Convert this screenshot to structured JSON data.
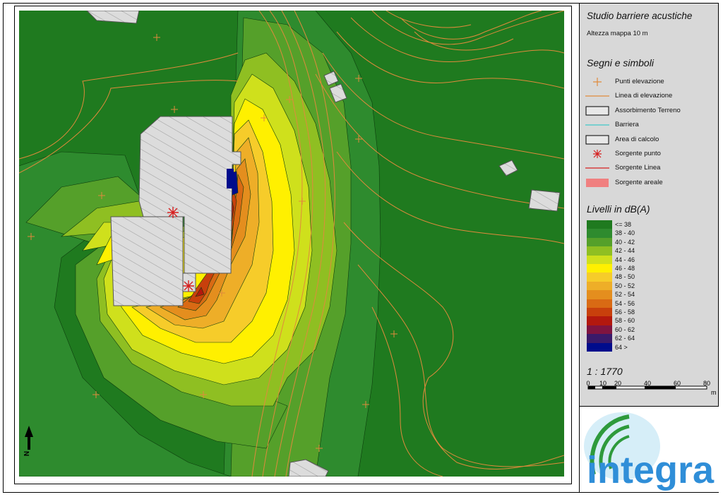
{
  "panel": {
    "title": "Studio barriere acustiche",
    "subtitle": "Altezza mappa 10 m",
    "legend_heading": "Segni e simboli",
    "legend_items": [
      {
        "label": "Punti elevazione",
        "symbol": "plus",
        "color": "#e08a3c"
      },
      {
        "label": "Linea di elevazione",
        "symbol": "line",
        "color": "#e08a3c"
      },
      {
        "label": "Assorbimento Terreno",
        "symbol": "box",
        "color": "#000000"
      },
      {
        "label": "Barriera",
        "symbol": "line",
        "color": "#40c8c8"
      },
      {
        "label": "Area di calcolo",
        "symbol": "box",
        "color": "#000000"
      },
      {
        "label": "Sorgente punto",
        "symbol": "asterisk",
        "color": "#d62020"
      },
      {
        "label": "Sorgente Linea",
        "symbol": "line",
        "color": "#d62020"
      },
      {
        "label": "Sorgente areale",
        "symbol": "fill",
        "color": "#f08080"
      }
    ],
    "levels_heading": "Livelli in dB(A)",
    "levels": [
      {
        "label": "<= 38",
        "color": "#1f7a1f"
      },
      {
        "label": "38  -  40",
        "color": "#2e8b2e"
      },
      {
        "label": "40  -  42",
        "color": "#55a02a"
      },
      {
        "label": "42  -  44",
        "color": "#8fbf22"
      },
      {
        "label": "44  -  46",
        "color": "#cfe01c"
      },
      {
        "label": "46  -  48",
        "color": "#fff000"
      },
      {
        "label": "48  -  50",
        "color": "#f6cc2a"
      },
      {
        "label": "50  -  52",
        "color": "#eeae28"
      },
      {
        "label": "52  -  54",
        "color": "#e48e1e"
      },
      {
        "label": "54  -  56",
        "color": "#d96a14"
      },
      {
        "label": "56  -  58",
        "color": "#c8400c"
      },
      {
        "label": "58  -  60",
        "color": "#b3180e"
      },
      {
        "label": "60  -  62",
        "color": "#7f1440"
      },
      {
        "label": "62  -  64",
        "color": "#3a1a6a"
      },
      {
        "label": "64  >",
        "color": "#000c8c"
      }
    ],
    "scale_text": "1 : 1770",
    "scale_ticks": [
      "0",
      "10",
      "20",
      "40",
      "60",
      "80"
    ],
    "scale_unit": "m",
    "logo_text": "integra"
  },
  "map": {
    "north_label": "N",
    "palette": {
      "background": "#1f7a1f",
      "building_fill": "#dcdcdc",
      "contour_line": "#e08a3c",
      "source": "#d62020"
    }
  }
}
